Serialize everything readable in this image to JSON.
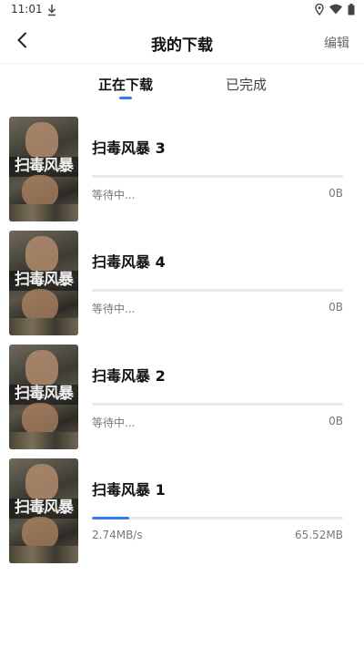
{
  "status_bar": {
    "time": "11:01",
    "download_icon": "download-icon",
    "icons": [
      "location-icon",
      "wifi-icon",
      "battery-icon"
    ]
  },
  "header": {
    "back_icon": "back-arrow-icon",
    "title": "我的下载",
    "edit_label": "编辑"
  },
  "tabs": [
    {
      "label": "正在下载",
      "active": true
    },
    {
      "label": "已完成",
      "active": false
    }
  ],
  "accent_color": "#2f7cf6",
  "downloads": [
    {
      "title": "扫毒风暴 3",
      "poster_text": "扫毒风暴",
      "status": "等待中...",
      "size": "0B",
      "progress": 0
    },
    {
      "title": "扫毒风暴 4",
      "poster_text": "扫毒风暴",
      "status": "等待中...",
      "size": "0B",
      "progress": 0
    },
    {
      "title": "扫毒风暴 2",
      "poster_text": "扫毒风暴",
      "status": "等待中...",
      "size": "0B",
      "progress": 0
    },
    {
      "title": "扫毒风暴 1",
      "poster_text": "扫毒风暴",
      "status": "2.74MB/s",
      "size": "65.52MB",
      "progress": 0.15
    }
  ]
}
